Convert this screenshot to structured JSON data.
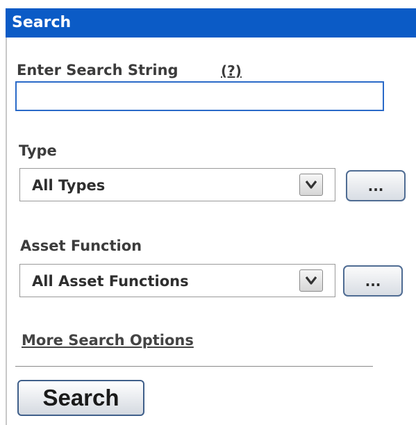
{
  "panel": {
    "title": "Search"
  },
  "search_string": {
    "label": "Enter Search String",
    "help_link": "(?)",
    "value": ""
  },
  "type_field": {
    "label": "Type",
    "selected": "All Types",
    "more_button": "..."
  },
  "asset_function_field": {
    "label": "Asset Function",
    "selected": "All Asset Functions",
    "more_button": "..."
  },
  "more_options_link": "More Search Options",
  "search_button": "Search",
  "colors": {
    "header_bg": "#0b5bc6",
    "input_border": "#2a6ac8"
  }
}
